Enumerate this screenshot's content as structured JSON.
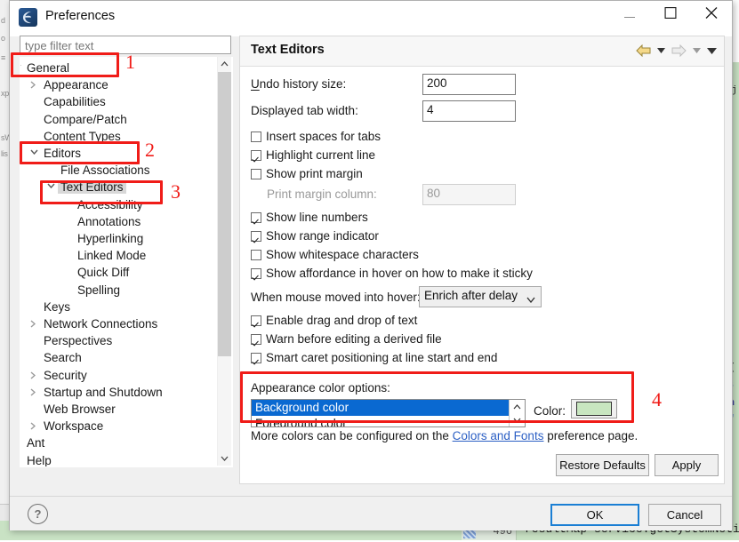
{
  "window": {
    "title": "Preferences",
    "icon": "eclipse-logo-icon",
    "minimize_label": "—",
    "maximize_label": "□",
    "close_label": "✕"
  },
  "filter": {
    "placeholder": "type filter text",
    "value": ""
  },
  "tree": {
    "items": [
      {
        "label": "General",
        "indent": 0,
        "twisty": "down",
        "selected": false
      },
      {
        "label": "Appearance",
        "indent": 1,
        "twisty": "right",
        "selected": false
      },
      {
        "label": "Capabilities",
        "indent": 1,
        "twisty": "none",
        "selected": false
      },
      {
        "label": "Compare/Patch",
        "indent": 1,
        "twisty": "none",
        "selected": false
      },
      {
        "label": "Content Types",
        "indent": 1,
        "twisty": "none",
        "selected": false
      },
      {
        "label": "Editors",
        "indent": 1,
        "twisty": "down",
        "selected": false
      },
      {
        "label": "File Associations",
        "indent": 2,
        "twisty": "none",
        "selected": false
      },
      {
        "label": "Text Editors",
        "indent": 2,
        "twisty": "down",
        "selected": true
      },
      {
        "label": "Accessibility",
        "indent": 3,
        "twisty": "none",
        "selected": false
      },
      {
        "label": "Annotations",
        "indent": 3,
        "twisty": "none",
        "selected": false
      },
      {
        "label": "Hyperlinking",
        "indent": 3,
        "twisty": "none",
        "selected": false
      },
      {
        "label": "Linked Mode",
        "indent": 3,
        "twisty": "none",
        "selected": false
      },
      {
        "label": "Quick Diff",
        "indent": 3,
        "twisty": "none",
        "selected": false
      },
      {
        "label": "Spelling",
        "indent": 3,
        "twisty": "none",
        "selected": false
      },
      {
        "label": "Keys",
        "indent": 1,
        "twisty": "none",
        "selected": false
      },
      {
        "label": "Network Connections",
        "indent": 1,
        "twisty": "right",
        "selected": false
      },
      {
        "label": "Perspectives",
        "indent": 1,
        "twisty": "none",
        "selected": false
      },
      {
        "label": "Search",
        "indent": 1,
        "twisty": "none",
        "selected": false
      },
      {
        "label": "Security",
        "indent": 1,
        "twisty": "right",
        "selected": false
      },
      {
        "label": "Startup and Shutdown",
        "indent": 1,
        "twisty": "right",
        "selected": false
      },
      {
        "label": "Web Browser",
        "indent": 1,
        "twisty": "none",
        "selected": false
      },
      {
        "label": "Workspace",
        "indent": 1,
        "twisty": "right",
        "selected": false
      },
      {
        "label": "Ant",
        "indent": 0,
        "twisty": "right",
        "selected": false
      },
      {
        "label": "Help",
        "indent": 0,
        "twisty": "right",
        "selected": false
      }
    ]
  },
  "page": {
    "title": "Text Editors",
    "toolbar": {
      "back": "back-arrow-icon",
      "back_menu": "back-dropdown-icon",
      "forward": "forward-arrow-icon",
      "forward_menu": "forward-dropdown-icon",
      "view_menu": "view-menu-icon"
    },
    "undo_history_label": "Undo history size:",
    "undo_history_value": "200",
    "tab_width_label": "Displayed tab width:",
    "tab_width_value": "4",
    "checkboxes": [
      {
        "label": "Insert spaces for tabs",
        "checked": false,
        "disabled": false
      },
      {
        "label": "Highlight current line",
        "checked": true,
        "disabled": false
      },
      {
        "label": "Show print margin",
        "checked": false,
        "disabled": false
      },
      {
        "label": "Show line numbers",
        "checked": true,
        "disabled": false
      },
      {
        "label": "Show range indicator",
        "checked": true,
        "disabled": false
      },
      {
        "label": "Show whitespace characters",
        "checked": false,
        "disabled": false
      },
      {
        "label": "Show affordance in hover on how to make it sticky",
        "checked": true,
        "disabled": false
      },
      {
        "label": "Enable drag and drop of text",
        "checked": true,
        "disabled": false
      },
      {
        "label": "Warn before editing a derived file",
        "checked": true,
        "disabled": false
      },
      {
        "label": "Smart caret positioning at line start and end",
        "checked": true,
        "disabled": false
      }
    ],
    "print_margin_label": "Print margin column:",
    "print_margin_value": "80",
    "hover_label": "When mouse moved into hover:",
    "hover_value": "Enrich after delay",
    "appearance_label": "Appearance color options:",
    "appearance_selected": "Background color",
    "appearance_second": "Foreground color",
    "color_label": "Color:",
    "color_value": "#c8e6c0",
    "note_prefix": "More colors can be configured on the ",
    "note_link": "Colors and Fonts",
    "note_suffix": " preference page."
  },
  "buttons": {
    "restore_defaults": "Restore Defaults",
    "apply": "Apply",
    "ok": "OK",
    "cancel": "Cancel",
    "help": "?"
  },
  "annotations": [
    {
      "number": "1"
    },
    {
      "number": "2"
    },
    {
      "number": "3"
    },
    {
      "number": "4"
    }
  ],
  "background": {
    "left_labels": [
      "d",
      "o",
      "≡",
      "xp",
      "sW",
      "lis"
    ],
    "code_line": "resultMap=service.getSystemNotic",
    "line_number": "496",
    "right_chars": [
      "j",
      "(",
      "8",
      "n",
      "\""
    ]
  },
  "colors": {
    "accent": "#0a69d1",
    "annotation": "#f01c18",
    "editor_bg": "#c9e2c4",
    "swatch": "#c8e6c0"
  }
}
